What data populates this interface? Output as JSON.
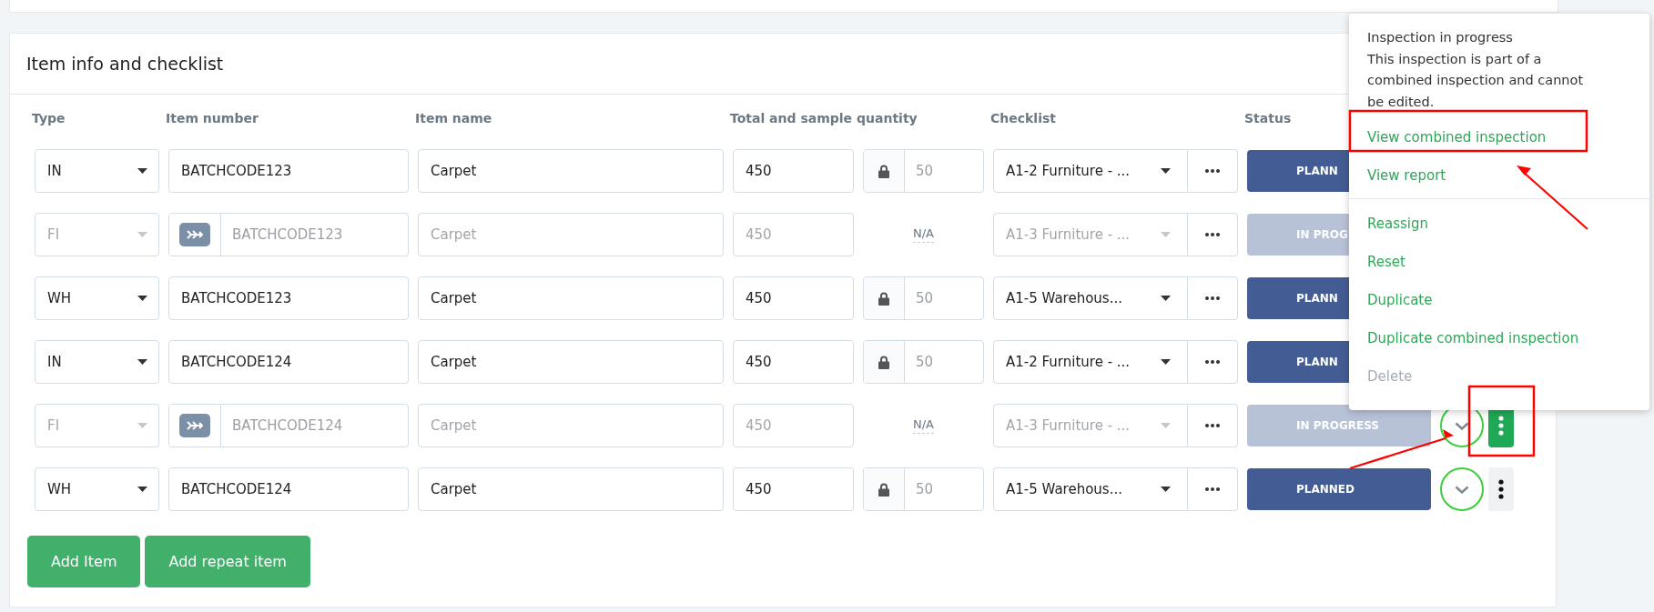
{
  "section": {
    "title": "Item info and checklist"
  },
  "columns": {
    "type": "Type",
    "item_number": "Item number",
    "item_name": "Item name",
    "quantity": "Total and sample quantity",
    "checklist": "Checklist",
    "status": "Status"
  },
  "rows": [
    {
      "kind": "main",
      "type": "IN",
      "item_number": "BATCHCODE123",
      "item_name": "Carpet",
      "total": "450",
      "sample": "50",
      "checklist": "A1-2 Furniture - ...",
      "status": {
        "kind": "planned",
        "label": "PLANN"
      }
    },
    {
      "kind": "repeat",
      "type": "FI",
      "item_number": "BATCHCODE123",
      "item_name": "Carpet",
      "total": "450",
      "sample": "N/A",
      "checklist": "A1-3 Furniture - ...",
      "status": {
        "kind": "in_progress",
        "label": "IN PROG"
      }
    },
    {
      "kind": "main",
      "type": "WH",
      "item_number": "BATCHCODE123",
      "item_name": "Carpet",
      "total": "450",
      "sample": "50",
      "checklist": "A1-5 Warehous...",
      "status": {
        "kind": "planned",
        "label": "PLANN"
      }
    },
    {
      "kind": "main",
      "type": "IN",
      "item_number": "BATCHCODE124",
      "item_name": "Carpet",
      "total": "450",
      "sample": "50",
      "checklist": "A1-2 Furniture - ...",
      "status": {
        "kind": "planned",
        "label": "PLANN"
      }
    },
    {
      "kind": "repeat",
      "type": "FI",
      "item_number": "BATCHCODE124",
      "item_name": "Carpet",
      "total": "450",
      "sample": "N/A",
      "checklist": "A1-3 Furniture - ...",
      "status": {
        "kind": "in_progress",
        "label": "IN PROGRESS"
      },
      "menu_open": true
    },
    {
      "kind": "main",
      "type": "WH",
      "item_number": "BATCHCODE124",
      "item_name": "Carpet",
      "total": "450",
      "sample": "50",
      "checklist": "A1-5 Warehous...",
      "status": {
        "kind": "planned",
        "label": "PLANNED"
      },
      "menu_open": false
    }
  ],
  "buttons": [
    "Add Item",
    "Add repeat item"
  ],
  "menu": {
    "heading": "Inspection in progress",
    "note": "This inspection is part of a combined inspection and cannot be edited.",
    "groups": [
      [
        {
          "label": "View combined inspection",
          "disabled": false
        },
        {
          "label": "View report",
          "disabled": false
        }
      ],
      [
        {
          "label": "Reassign",
          "disabled": false
        },
        {
          "label": "Reset",
          "disabled": false
        },
        {
          "label": "Duplicate",
          "disabled": false
        },
        {
          "label": "Duplicate combined inspection",
          "disabled": false
        },
        {
          "label": "Delete",
          "disabled": true
        }
      ]
    ]
  }
}
